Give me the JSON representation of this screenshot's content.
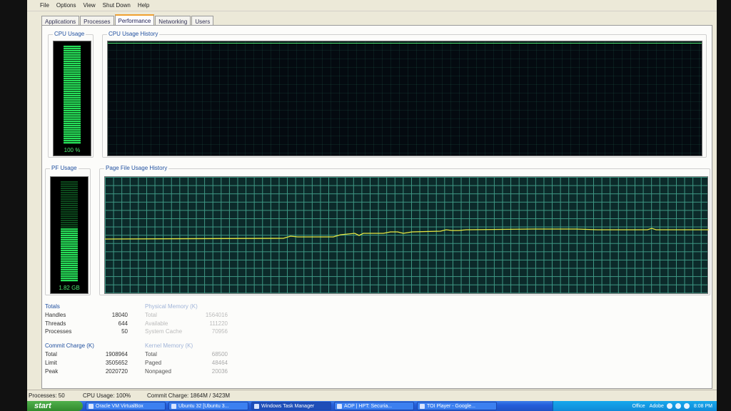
{
  "menu": [
    "File",
    "Options",
    "View",
    "Shut Down",
    "Help"
  ],
  "tabs": [
    {
      "label": "Applications",
      "active": false
    },
    {
      "label": "Processes",
      "active": false
    },
    {
      "label": "Performance",
      "active": true
    },
    {
      "label": "Networking",
      "active": false
    },
    {
      "label": "Users",
      "active": false
    }
  ],
  "cpu_usage": {
    "label": "CPU Usage",
    "value": "100 %",
    "level": 1.0
  },
  "cpu_history": {
    "label": "CPU Usage History"
  },
  "pf_usage": {
    "label": "PF Usage",
    "value": "1.82 GB",
    "level": 0.53
  },
  "pf_history": {
    "label": "Page File Usage History"
  },
  "totals": {
    "title": "Totals",
    "rows": [
      {
        "label": "Handles",
        "value": "18040"
      },
      {
        "label": "Threads",
        "value": "644"
      },
      {
        "label": "Processes",
        "value": "50"
      }
    ]
  },
  "physical_memory": {
    "title": "Physical Memory (K)",
    "rows": [
      {
        "label": "Total",
        "value": "1564016"
      },
      {
        "label": "Available",
        "value": "111220"
      },
      {
        "label": "System Cache",
        "value": "70956"
      }
    ]
  },
  "commit_charge": {
    "title": "Commit Charge (K)",
    "rows": [
      {
        "label": "Total",
        "value": "1908964"
      },
      {
        "label": "Limit",
        "value": "3505652"
      },
      {
        "label": "Peak",
        "value": "2020720"
      }
    ]
  },
  "kernel_memory": {
    "title": "Kernel Memory (K)",
    "rows": [
      {
        "label": "Total",
        "value": "68500"
      },
      {
        "label": "Paged",
        "value": "48464"
      },
      {
        "label": "Nonpaged",
        "value": "20036"
      }
    ]
  },
  "status": {
    "processes": "Processes: 50",
    "cpu": "CPU Usage: 100%",
    "commit": "Commit Charge: 1864M / 3423M"
  },
  "taskbar": {
    "start": "start",
    "items": [
      {
        "label": "Oracle VM VirtualBox",
        "active": false
      },
      {
        "label": "Ubuntu 32 [Ubuntu 3...",
        "active": false
      },
      {
        "label": "Windows Task Manager",
        "active": true
      },
      {
        "label": "AOP | HPT: Securia...",
        "active": false
      },
      {
        "label": "TOI Player - Google...",
        "active": false
      }
    ],
    "tray": [
      "Office",
      "Adobe"
    ],
    "clock": "8:08 PM"
  },
  "colors": {
    "meter_green": "#27e05a",
    "pf_line": "#e8e840",
    "grid": "#3f9a86",
    "tab_highlight": "#f0a030"
  }
}
